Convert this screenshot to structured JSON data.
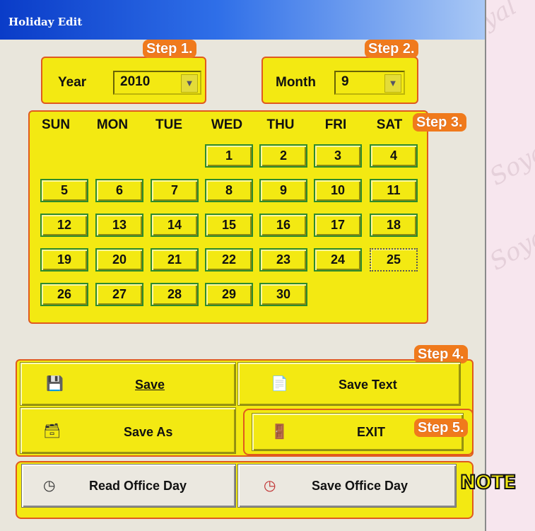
{
  "window": {
    "title": "Holiday Edit"
  },
  "watermark": "Soyal",
  "steps": [
    "Step 1.",
    "Step 2.",
    "Step 3.",
    "Step 4.",
    "Step 5."
  ],
  "year": {
    "label": "Year",
    "value": "2010"
  },
  "month": {
    "label": "Month",
    "value": "9"
  },
  "calendar": {
    "weekdays": [
      "SUN",
      "MON",
      "TUE",
      "WED",
      "THU",
      "FRI",
      "SAT"
    ],
    "days": [
      "1",
      "2",
      "3",
      "4",
      "5",
      "6",
      "7",
      "8",
      "9",
      "10",
      "11",
      "12",
      "13",
      "14",
      "15",
      "16",
      "17",
      "18",
      "19",
      "20",
      "21",
      "22",
      "23",
      "24",
      "25",
      "26",
      "27",
      "28",
      "29",
      "30"
    ],
    "selected_day": "25"
  },
  "buttons": {
    "save": "Save",
    "save_text": "Save Text",
    "save_as": "Save As",
    "exit": "EXIT",
    "read_office_day": "Read Office Day",
    "save_office_day": "Save Office Day"
  },
  "note": "NOTE",
  "colors": {
    "panel": "#f3e912",
    "step_badge": "#f07a1c",
    "border": "#e05a1e",
    "title_start": "#0a3cc8"
  },
  "icons": [
    "floppy-icon",
    "text-file-icon",
    "multi-floppy-icon",
    "exit-door-icon",
    "clock-icon",
    "clock-icon"
  ]
}
